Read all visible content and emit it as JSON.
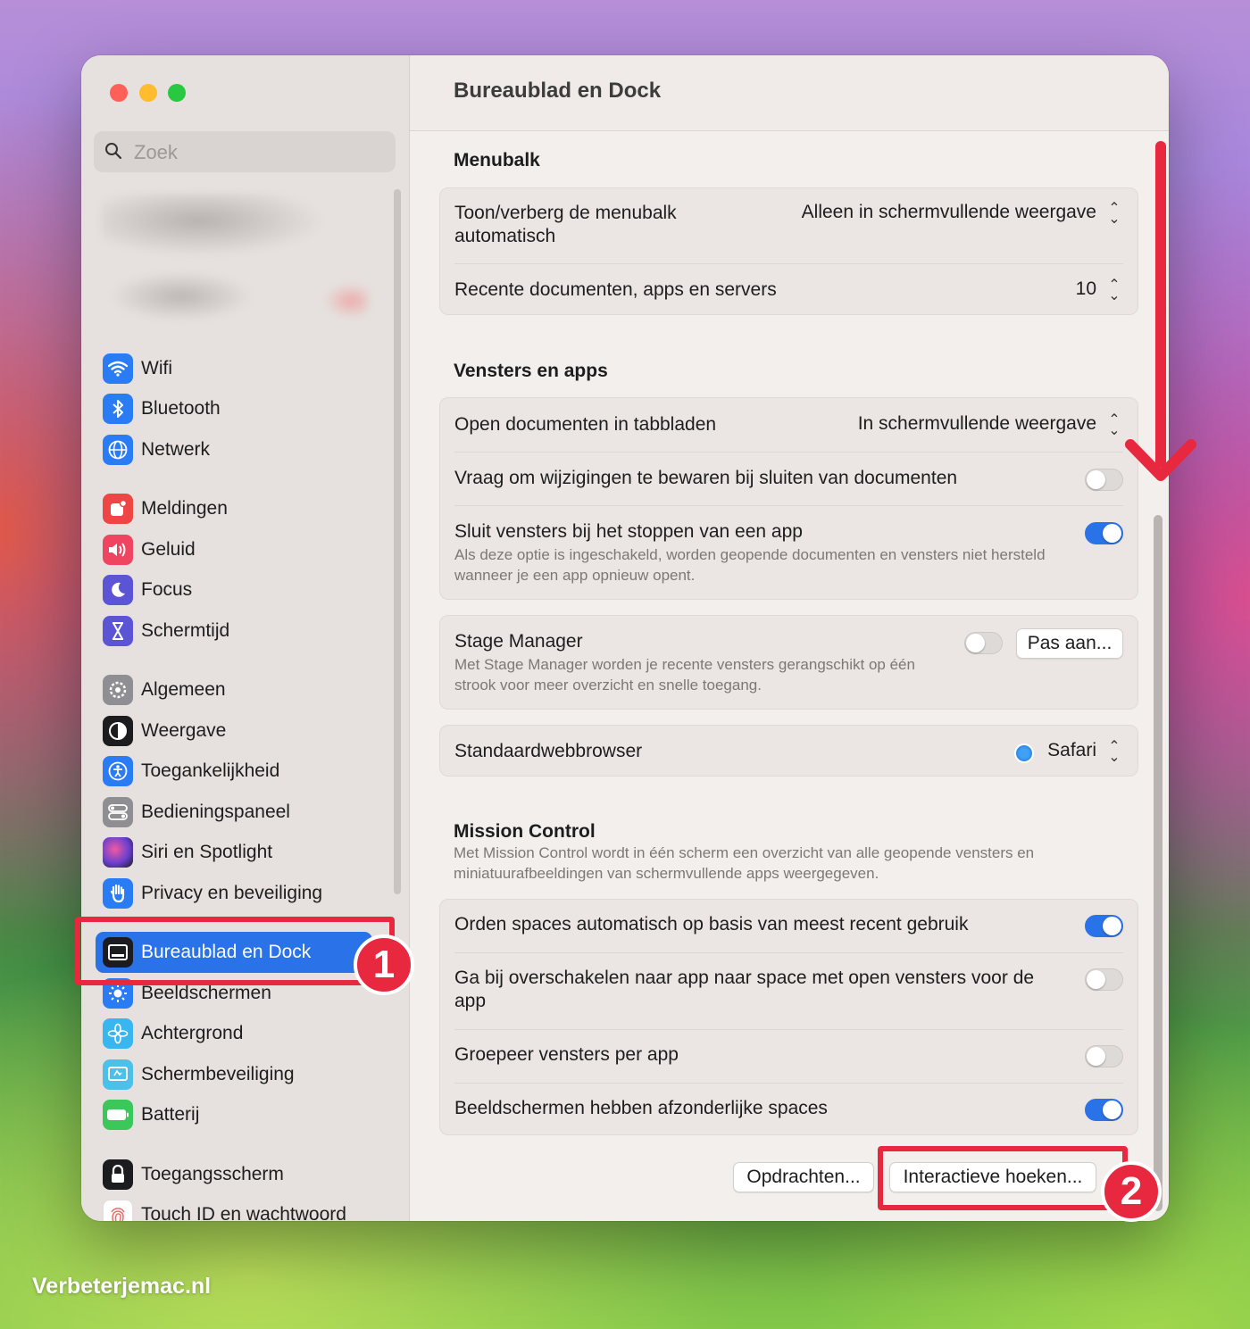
{
  "search": {
    "placeholder": "Zoek"
  },
  "sidebar": {
    "items": [
      {
        "label": "Wifi",
        "icon": "wifi-icon",
        "color": "#2a7cf5"
      },
      {
        "label": "Bluetooth",
        "icon": "bluetooth-icon",
        "color": "#2a7cf5"
      },
      {
        "label": "Netwerk",
        "icon": "globe-icon",
        "color": "#2a7cf5"
      },
      {
        "label": "Meldingen",
        "icon": "bell-icon",
        "color": "#f04545"
      },
      {
        "label": "Geluid",
        "icon": "speaker-icon",
        "color": "#f04560"
      },
      {
        "label": "Focus",
        "icon": "moon-icon",
        "color": "#5b55d6"
      },
      {
        "label": "Schermtijd",
        "icon": "hourglass-icon",
        "color": "#5b55d6"
      },
      {
        "label": "Algemeen",
        "icon": "gear-icon",
        "color": "#8e8e93"
      },
      {
        "label": "Weergave",
        "icon": "appearance-icon",
        "color": "#1c1c1e"
      },
      {
        "label": "Toegankelijkheid",
        "icon": "accessibility-icon",
        "color": "#2a7cf5"
      },
      {
        "label": "Bedieningspaneel",
        "icon": "control-center-icon",
        "color": "#8e8e93"
      },
      {
        "label": "Siri en Spotlight",
        "icon": "siri-icon",
        "color": "#6a3fd0"
      },
      {
        "label": "Privacy en beveiliging",
        "icon": "hand-icon",
        "color": "#2a7cf5"
      },
      {
        "label": "Bureaublad en Dock",
        "icon": "dock-icon",
        "color": "#1c1c1e"
      },
      {
        "label": "Beeldschermen",
        "icon": "sun-icon",
        "color": "#2a7cf5"
      },
      {
        "label": "Achtergrond",
        "icon": "flower-icon",
        "color": "#38b6f0"
      },
      {
        "label": "Schermbeveiliging",
        "icon": "screensaver-icon",
        "color": "#4cc0e8"
      },
      {
        "label": "Batterij",
        "icon": "battery-icon",
        "color": "#3cc75a"
      },
      {
        "label": "Toegangsscherm",
        "icon": "lock-icon",
        "color": "#1c1c1e"
      },
      {
        "label": "Touch ID en wachtwoord",
        "icon": "fingerprint-icon",
        "color": "#f06a6a"
      }
    ]
  },
  "main": {
    "title": "Bureaublad en Dock",
    "menubalk": {
      "title": "Menubalk",
      "autohide_label": "Toon/verberg de menubalk automatisch",
      "autohide_value": "Alleen in schermvullende weergave",
      "recent_label": "Recente documenten, apps en servers",
      "recent_value": "10"
    },
    "vensters": {
      "title": "Vensters en apps",
      "tabs_label": "Open documenten in tabbladen",
      "tabs_value": "In schermvullende weergave",
      "ask_label": "Vraag om wijzigingen te bewaren bij sluiten van documenten",
      "close_label": "Sluit vensters bij het stoppen van een app",
      "close_sub": "Als deze optie is ingeschakeld, worden geopende documenten en vensters niet hersteld wanneer je een app opnieuw opent.",
      "stage_label": "Stage Manager",
      "stage_sub": "Met Stage Manager worden je recente vensters gerangschikt op één strook voor meer overzicht en snelle toegang.",
      "stage_button": "Pas aan...",
      "browser_label": "Standaardwebbrowser",
      "browser_value": "Safari"
    },
    "mission": {
      "title": "Mission Control",
      "sub": "Met Mission Control wordt in één scherm een overzicht van alle geopende vensters en miniatuurafbeeldingen van schermvullende apps weergegeven.",
      "spaces_label": "Orden spaces automatisch op basis van meest recent gebruik",
      "switch_label": "Ga bij overschakelen naar app naar space met open vensters voor de app",
      "group_label": "Groepeer vensters per app",
      "displays_label": "Beeldschermen hebben afzonderlijke spaces",
      "shortcuts_button": "Opdrachten...",
      "corners_button": "Interactieve hoeken..."
    }
  },
  "annotations": {
    "badge1": "1",
    "badge2": "2"
  },
  "watermark": "Verbeterjemac.nl"
}
